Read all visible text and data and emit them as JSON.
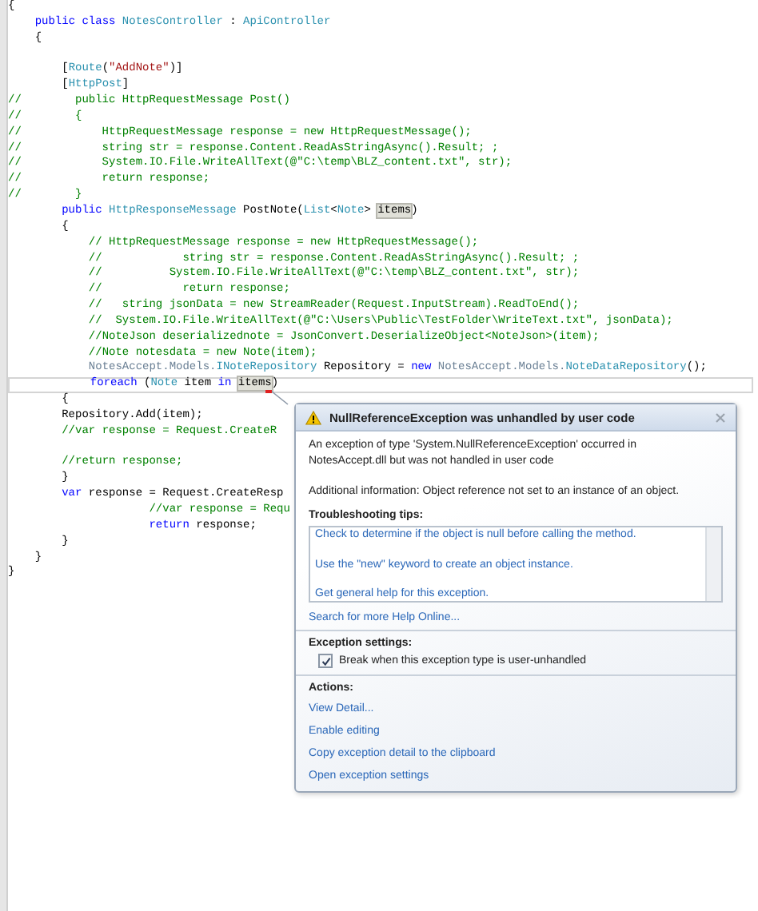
{
  "editor": {
    "lines": [
      {
        "current": false,
        "segments": [
          {
            "kind": "plain",
            "text": "{"
          }
        ]
      },
      {
        "current": false,
        "segments": [
          {
            "kind": "keyword",
            "text": "    public class "
          },
          {
            "kind": "type",
            "text": "NotesController"
          },
          {
            "kind": "plain",
            "text": " : "
          },
          {
            "kind": "type",
            "text": "ApiController"
          }
        ]
      },
      {
        "current": false,
        "segments": [
          {
            "kind": "plain",
            "text": "    {"
          }
        ]
      },
      {
        "current": false
      },
      {
        "current": false,
        "segments": [
          {
            "kind": "plain",
            "text": "        ["
          },
          {
            "kind": "type",
            "text": "Route"
          },
          {
            "kind": "plain",
            "text": "("
          },
          {
            "kind": "string",
            "text": "\"AddNote\""
          },
          {
            "kind": "plain",
            "text": ")]"
          }
        ]
      },
      {
        "current": false,
        "segments": [
          {
            "kind": "plain",
            "text": "        ["
          },
          {
            "kind": "type",
            "text": "HttpPost"
          },
          {
            "kind": "plain",
            "text": "]"
          }
        ]
      },
      {
        "current": false,
        "segments": [
          {
            "kind": "comment",
            "text": "//        public HttpRequestMessage Post()"
          }
        ]
      },
      {
        "current": false,
        "segments": [
          {
            "kind": "comment",
            "text": "//        {"
          }
        ]
      },
      {
        "current": false,
        "segments": [
          {
            "kind": "comment",
            "text": "//            HttpRequestMessage response = new HttpRequestMessage();"
          }
        ]
      },
      {
        "current": false,
        "segments": [
          {
            "kind": "comment",
            "text": "//            string str = response.Content.ReadAsStringAsync().Result; ;"
          }
        ]
      },
      {
        "current": false,
        "segments": [
          {
            "kind": "comment",
            "text": "//            System.IO.File.WriteAllText(@\"C:\\temp\\BLZ_content.txt\", str);"
          }
        ]
      },
      {
        "current": false,
        "segments": [
          {
            "kind": "comment",
            "text": "//            return response;"
          }
        ]
      },
      {
        "current": false,
        "segments": [
          {
            "kind": "comment",
            "text": "//        }"
          }
        ]
      },
      {
        "current": false,
        "segments": [
          {
            "kind": "keyword",
            "text": "        public "
          },
          {
            "kind": "type",
            "text": "HttpResponseMessage"
          },
          {
            "kind": "plain",
            "text": " PostNote("
          },
          {
            "kind": "type",
            "text": "List"
          },
          {
            "kind": "plain",
            "text": "<"
          },
          {
            "kind": "type",
            "text": "Note"
          },
          {
            "kind": "plain",
            "text": "> "
          },
          {
            "kind": "reference",
            "text": "items"
          },
          {
            "kind": "plain",
            "text": ")"
          }
        ]
      },
      {
        "current": false,
        "segments": [
          {
            "kind": "plain",
            "text": "        {"
          }
        ]
      },
      {
        "current": false,
        "segments": [
          {
            "kind": "comment",
            "text": "            // HttpRequestMessage response = new HttpRequestMessage();"
          }
        ]
      },
      {
        "current": false,
        "segments": [
          {
            "kind": "comment",
            "text": "            //            string str = response.Content.ReadAsStringAsync().Result; ;"
          }
        ]
      },
      {
        "current": false,
        "segments": [
          {
            "kind": "comment",
            "text": "            //          System.IO.File.WriteAllText(@\"C:\\temp\\BLZ_content.txt\", str);"
          }
        ]
      },
      {
        "current": false,
        "segments": [
          {
            "kind": "comment",
            "text": "            //            return response;"
          }
        ]
      },
      {
        "current": false,
        "segments": [
          {
            "kind": "comment",
            "text": "            //   string jsonData = new StreamReader(Request.InputStream).ReadToEnd();"
          }
        ]
      },
      {
        "current": false,
        "segments": [
          {
            "kind": "comment",
            "text": "            //  System.IO.File.WriteAllText(@\"C:\\Users\\Public\\TestFolder\\WriteText.txt\", jsonData);"
          }
        ]
      },
      {
        "current": false,
        "segments": [
          {
            "kind": "comment",
            "text": "            //NoteJson deserializednote = JsonConvert.DeserializeObject<NoteJson>(item);"
          }
        ]
      },
      {
        "current": false,
        "segments": [
          {
            "kind": "comment",
            "text": "            //Note notesdata = new Note(item);"
          }
        ]
      },
      {
        "current": false,
        "segments": [
          {
            "kind": "namespace",
            "text": "            NotesAccept.Models."
          },
          {
            "kind": "type",
            "text": "INoteRepository"
          },
          {
            "kind": "plain",
            "text": " Repository = "
          },
          {
            "kind": "keyword",
            "text": "new "
          },
          {
            "kind": "namespace",
            "text": "NotesAccept.Models."
          },
          {
            "kind": "type",
            "text": "NoteDataRepository"
          },
          {
            "kind": "plain",
            "text": "();"
          }
        ]
      },
      {
        "current": true,
        "segments": [
          {
            "kind": "keyword",
            "text": "            foreach"
          },
          {
            "kind": "plain",
            "text": " ("
          },
          {
            "kind": "type",
            "text": "Note"
          },
          {
            "kind": "plain",
            "text": " item "
          },
          {
            "kind": "keyword",
            "text": "in "
          },
          {
            "kind": "reference",
            "text": "items"
          },
          {
            "kind": "plain",
            "text": ")"
          }
        ]
      },
      {
        "current": false,
        "segments": [
          {
            "kind": "plain",
            "text": "        {"
          }
        ]
      },
      {
        "current": false,
        "segments": [
          {
            "kind": "plain",
            "text": "        Repository.Add(item);"
          }
        ]
      },
      {
        "current": false,
        "segments": [
          {
            "kind": "comment",
            "text": "        //var response = Request.CreateR"
          }
        ]
      },
      {
        "current": false
      },
      {
        "current": false,
        "segments": [
          {
            "kind": "comment",
            "text": "        //return response;"
          }
        ]
      },
      {
        "current": false,
        "segments": [
          {
            "kind": "plain",
            "text": "        }"
          }
        ]
      },
      {
        "current": false,
        "segments": [
          {
            "kind": "keyword",
            "text": "        var"
          },
          {
            "kind": "plain",
            "text": " response = Request.CreateResp"
          }
        ]
      },
      {
        "current": false,
        "segments": [
          {
            "kind": "comment",
            "text": "                     //var response = Requ"
          }
        ]
      },
      {
        "current": false,
        "segments": [
          {
            "kind": "keyword",
            "text": "                     return"
          },
          {
            "kind": "plain",
            "text": " response;"
          }
        ]
      },
      {
        "current": false,
        "segments": [
          {
            "kind": "plain",
            "text": "        }"
          }
        ]
      },
      {
        "current": false,
        "segments": [
          {
            "kind": "plain",
            "text": "    }"
          }
        ]
      },
      {
        "current": false,
        "segments": [
          {
            "kind": "plain",
            "text": "}"
          }
        ]
      }
    ]
  },
  "exception_popup": {
    "title": "NullReferenceException was unhandled by user code",
    "message": "An exception of type 'System.NullReferenceException' occurred in NotesAccept.dll but was not handled in user code",
    "additional_info": "Additional information: Object reference not set to an instance of an object.",
    "tips_heading": "Troubleshooting tips:",
    "tips": [
      "Check to determine if the object is null before calling the method.",
      "Use the \"new\" keyword to create an object instance.",
      "Get general help for this exception."
    ],
    "help_link": "Search for more Help Online...",
    "settings_heading": "Exception settings:",
    "break_option": {
      "label": "Break when this exception type is user-unhandled",
      "checked": true
    },
    "actions_heading": "Actions:",
    "actions": [
      "View Detail...",
      "Enable editing",
      "Copy exception detail to the clipboard",
      "Open exception settings"
    ]
  }
}
